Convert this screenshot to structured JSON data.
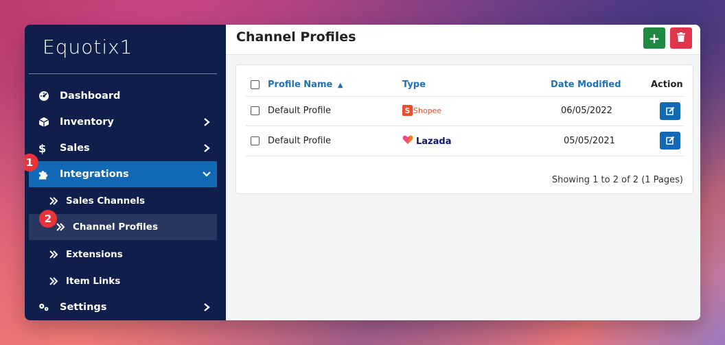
{
  "app": {
    "logo_text": "Equotix1"
  },
  "sidebar": {
    "items": [
      {
        "label": "Dashboard",
        "icon": "dashboard-icon"
      },
      {
        "label": "Inventory",
        "icon": "box-icon"
      },
      {
        "label": "Sales",
        "icon": "dollar-icon"
      },
      {
        "label": "Integrations",
        "icon": "puzzle-icon"
      },
      {
        "label": "Settings",
        "icon": "gears-icon"
      }
    ],
    "subitems": [
      {
        "label": "Sales Channels"
      },
      {
        "label": "Channel Profiles"
      },
      {
        "label": "Extensions"
      },
      {
        "label": "Item Links"
      }
    ]
  },
  "badges": {
    "one": "1",
    "two": "2"
  },
  "header": {
    "title": "Channel Profiles",
    "add_label": "+"
  },
  "table": {
    "columns": [
      "Profile Name",
      "Type",
      "Date Modified",
      "Action"
    ],
    "rows": [
      {
        "name": "Default Profile",
        "type": "Shopee",
        "date": "06/05/2022"
      },
      {
        "name": "Default Profile",
        "type": "Lazada",
        "date": "05/05/2021"
      }
    ],
    "footer": "Showing 1 to 2 of 2 (1 Pages)"
  },
  "colors": {
    "sidebar_bg": "#0f1e4a",
    "active_item": "#1168b4",
    "active_sub": "#27375f",
    "link_blue": "#1f6fb8",
    "add_green": "#1e8a44",
    "delete_red": "#e2374a",
    "badge_red": "#e8323c"
  }
}
